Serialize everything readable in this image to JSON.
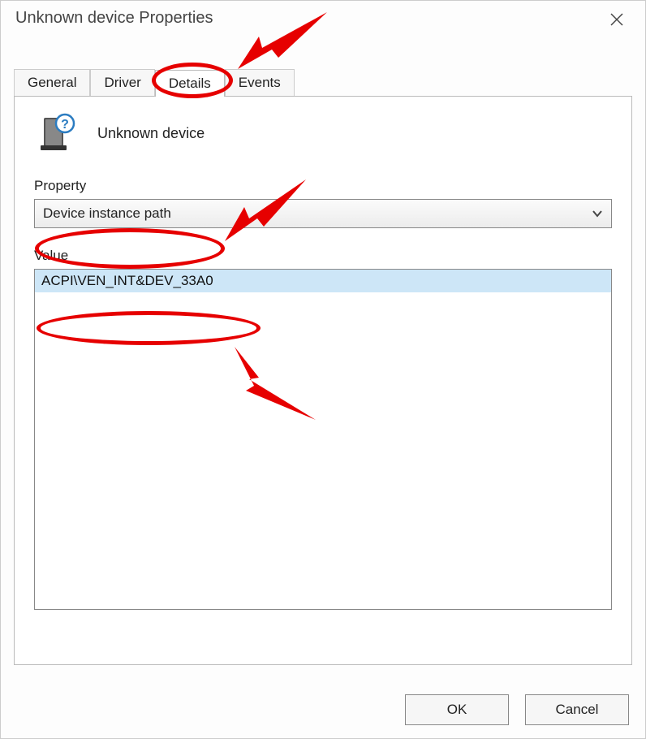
{
  "window": {
    "title": "Unknown device Properties"
  },
  "tabs": {
    "general": "General",
    "driver": "Driver",
    "details": "Details",
    "events": "Events"
  },
  "device": {
    "name": "Unknown device"
  },
  "labels": {
    "property": "Property",
    "value": "Value"
  },
  "dropdown": {
    "selected": "Device instance path"
  },
  "value": {
    "line": "ACPI\\VEN_INT&DEV_33A0"
  },
  "buttons": {
    "ok": "OK",
    "cancel": "Cancel"
  }
}
